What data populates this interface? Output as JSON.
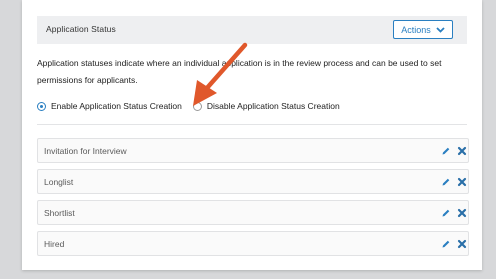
{
  "header": {
    "title": "Application Status",
    "actions_label": "Actions"
  },
  "description": "Application statuses indicate where an individual application is in the review process and can be used to set permissions for applicants.",
  "radio_options": {
    "enable_label": "Enable Application Status Creation",
    "disable_label": "Disable Application Status Creation",
    "selected": "enable"
  },
  "statuses": [
    {
      "label": "Invitation for Interview"
    },
    {
      "label": "Longlist"
    },
    {
      "label": "Shortlist"
    },
    {
      "label": "Hired"
    }
  ],
  "colors": {
    "accent": "#2a7fc1",
    "annotation_arrow": "#e0582b",
    "delete": "#2a6fa8"
  },
  "icons": [
    "chevron-down-icon",
    "pencil-icon",
    "close-icon",
    "annotation-arrow"
  ]
}
